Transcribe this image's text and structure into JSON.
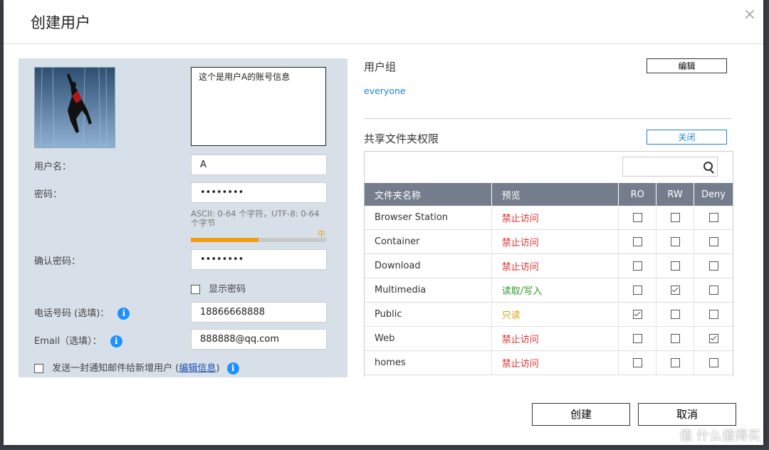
{
  "dialog": {
    "title": "创建用户",
    "close_symbol": "×"
  },
  "user": {
    "description": "这个是用户A的账号信息",
    "username_label": "用户名：",
    "username": "A",
    "password_label": "密码：",
    "password": "••••••••",
    "password_hint": "ASCII: 0-64 个字符，UTF-8: 0-64 个字节",
    "strength_label": "中",
    "strength_level": 0.5,
    "confirm_label": "确认密码：",
    "confirm_password": "••••••••",
    "show_password_label": "显示密码",
    "phone_label": "电话号码 (选填)：",
    "phone": "18866668888",
    "email_label": "Email（选填）：",
    "email": "888888@qq.com",
    "notify_label": "发送一封通知邮件给新增用户 (",
    "notify_link": "编辑信息",
    "notify_close": ")",
    "info_symbol": "i"
  },
  "groups": {
    "title": "用户组",
    "edit_label": "编辑",
    "value": "everyone"
  },
  "shares": {
    "title": "共享文件夹权限",
    "close_label": "关闭",
    "columns": [
      "文件夹名称",
      "预览",
      "RO",
      "RW",
      "Deny"
    ],
    "rows": [
      {
        "name": "Browser Station",
        "preview": "禁止访问",
        "kind": "deny",
        "ro": false,
        "rw": false,
        "deny": false
      },
      {
        "name": "Container",
        "preview": "禁止访问",
        "kind": "deny",
        "ro": false,
        "rw": false,
        "deny": false
      },
      {
        "name": "Download",
        "preview": "禁止访问",
        "kind": "deny",
        "ro": false,
        "rw": false,
        "deny": false
      },
      {
        "name": "Multimedia",
        "preview": "读取/写入",
        "kind": "rw",
        "ro": false,
        "rw": true,
        "deny": false
      },
      {
        "name": "Public",
        "preview": "只读",
        "kind": "ro",
        "ro": true,
        "rw": false,
        "deny": false
      },
      {
        "name": "Web",
        "preview": "禁止访问",
        "kind": "deny",
        "ro": false,
        "rw": false,
        "deny": true
      },
      {
        "name": "homes",
        "preview": "禁止访问",
        "kind": "deny",
        "ro": false,
        "rw": false,
        "deny": false
      }
    ]
  },
  "footer": {
    "create_label": "创建",
    "cancel_label": "取消"
  },
  "watermark": "值 什么值得买"
}
